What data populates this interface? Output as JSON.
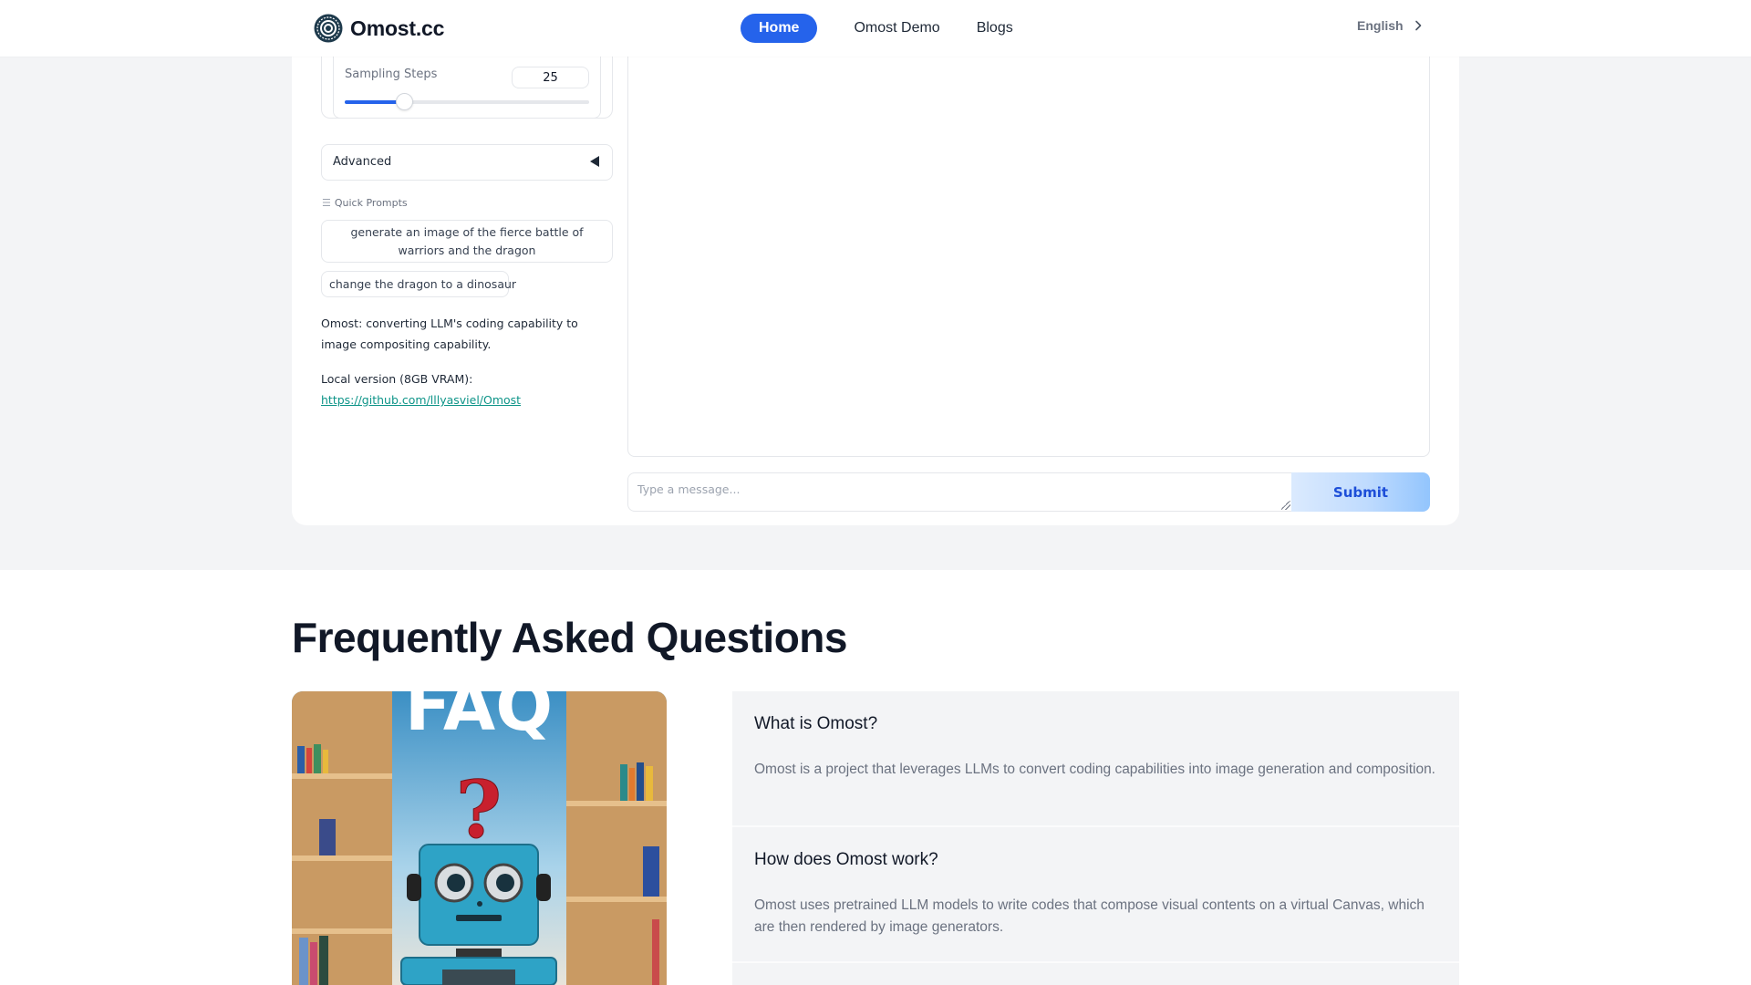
{
  "header": {
    "logo_text": "Omost.cc",
    "logo_icon": "concentric-circle-logo-icon",
    "nav": [
      {
        "label": "Home",
        "active": true
      },
      {
        "label": "Omost Demo",
        "active": false
      },
      {
        "label": "Blogs",
        "active": false
      }
    ],
    "language": "English",
    "language_icon": "chevron-right-icon"
  },
  "app": {
    "sampling_steps": {
      "label": "Sampling Steps",
      "value": "25",
      "min": 1,
      "max": 100,
      "current": 25
    },
    "advanced": {
      "label": "Advanced",
      "icon": "triangle-left-icon"
    },
    "quick_prompts": {
      "label": "Quick Prompts",
      "icon": "list-icon",
      "items": [
        "generate an image of the fierce battle of warriors and the dragon",
        "change the dragon to a dinosaur"
      ]
    },
    "description": "Omost: converting LLM's coding capability to image compositing capability.",
    "local_version_label": "Local version (8GB VRAM):",
    "local_version_link": "https://github.com/lllyasviel/Omost",
    "message_placeholder": "Type a message...",
    "message_value": "",
    "submit_label": "Submit"
  },
  "faq": {
    "title": "Frequently Asked Questions",
    "image_alt": "FAQ robot illustration",
    "items": [
      {
        "question": "What is Omost?",
        "answer": "Omost is a project that leverages LLMs to convert coding capabilities into image generation and composition."
      },
      {
        "question": "How does Omost work?",
        "answer": "Omost uses pretrained LLM models to write codes that compose visual contents on a virtual Canvas, which are then rendered by image generators."
      }
    ]
  },
  "colors": {
    "accent": "#2563eb",
    "link": "#0d9488",
    "page_bg": "#f3f4f6",
    "faq_item_bg": "#f3f4f6"
  }
}
